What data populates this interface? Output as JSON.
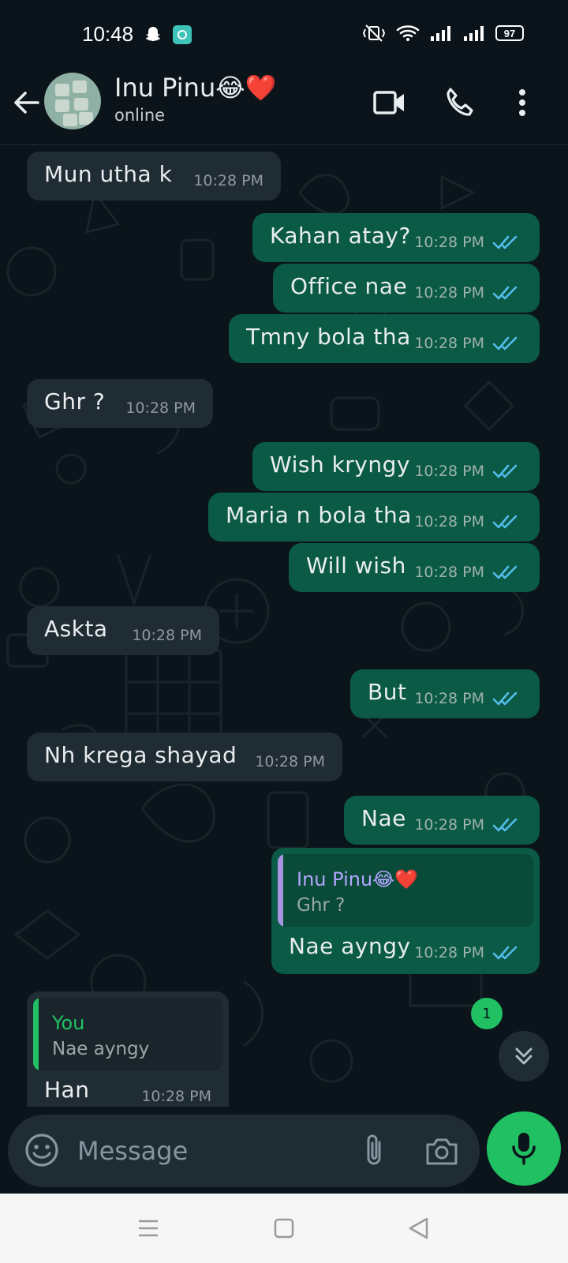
{
  "status_bar": {
    "time": "10:48",
    "battery": "97"
  },
  "header": {
    "name": "Inu Pinu😂❤️",
    "status": "online"
  },
  "messages": [
    {
      "dir": "in",
      "text": "Mun utha k",
      "time": "10:28 PM"
    },
    {
      "dir": "out",
      "text": "Kahan atay?",
      "time": "10:28 PM"
    },
    {
      "dir": "out",
      "text": "Office nae",
      "time": "10:28 PM"
    },
    {
      "dir": "out",
      "text": "Tmny bola tha",
      "time": "10:28 PM"
    },
    {
      "dir": "in",
      "text": "Ghr ?",
      "time": "10:28 PM"
    },
    {
      "dir": "out",
      "text": "Wish kryngy",
      "time": "10:28 PM"
    },
    {
      "dir": "out",
      "text": "Maria n bola tha",
      "time": "10:28 PM"
    },
    {
      "dir": "out",
      "text": "Will wish",
      "time": "10:28 PM"
    },
    {
      "dir": "in",
      "text": "Askta",
      "time": "10:28 PM"
    },
    {
      "dir": "out",
      "text": "But",
      "time": "10:28 PM"
    },
    {
      "dir": "in",
      "text": "Nh krega shayad",
      "time": "10:28 PM"
    },
    {
      "dir": "out",
      "text": "Nae",
      "time": "10:28 PM"
    },
    {
      "dir": "out",
      "text": "Nae ayngy",
      "time": "10:28 PM",
      "quote": {
        "name": "Inu Pinu😂❤️",
        "text": "Ghr ?"
      }
    },
    {
      "dir": "in",
      "text": "Han",
      "time": "10:28 PM",
      "quote": {
        "name": "You",
        "text": "Nae ayngy"
      }
    }
  ],
  "unread_count": "1",
  "input": {
    "placeholder": "Message"
  },
  "icons": {
    "back": "back-arrow-icon",
    "video": "video-call-icon",
    "call": "phone-icon",
    "menu": "more-vert-icon",
    "emoji": "emoji-icon",
    "attach": "attach-icon",
    "camera": "camera-icon",
    "mic": "mic-icon",
    "scroll": "double-chevron-down-icon"
  },
  "colors": {
    "background": "#0b141a",
    "incoming_bubble": "#202c33",
    "outgoing_bubble": "#0b5a45",
    "accent_green": "#21c063",
    "read_ticks": "#53bdeb",
    "quote_self": "#21c063",
    "quote_contact": "#a594e0"
  }
}
